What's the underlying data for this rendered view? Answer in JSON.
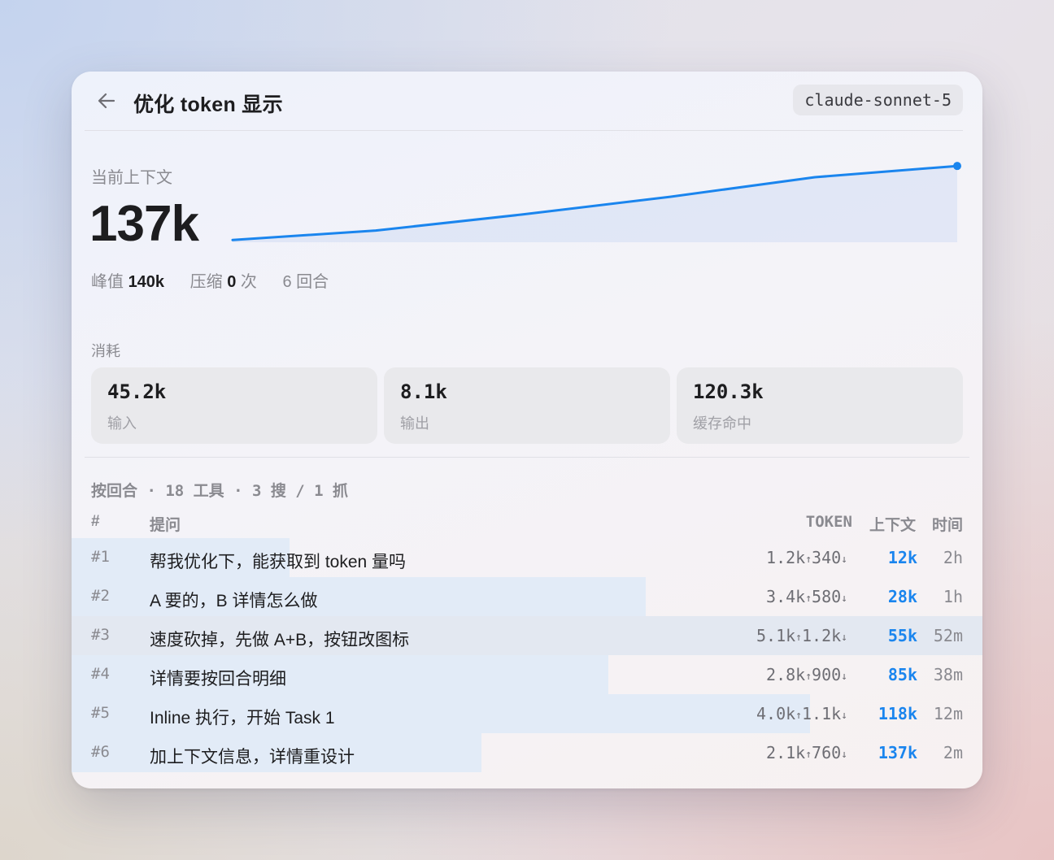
{
  "header": {
    "title": "优化 token 显示",
    "model": "claude-sonnet-5"
  },
  "context": {
    "label": "当前上下文",
    "value": "137k",
    "peak_label": "峰值",
    "peak_value": "140k",
    "compress_label": "压缩",
    "compress_value": "0",
    "compress_unit": "次",
    "rounds": "6 回合"
  },
  "chart_data": {
    "type": "area",
    "x": [
      1,
      2,
      3,
      4,
      5,
      6
    ],
    "values": [
      12,
      28,
      55,
      85,
      118,
      137
    ],
    "unit": "k",
    "color": "#1a85ee"
  },
  "usage": {
    "label": "消耗",
    "cards": [
      {
        "value": "45.2k",
        "label": "输入"
      },
      {
        "value": "8.1k",
        "label": "输出"
      },
      {
        "value": "120.3k",
        "label": "缓存命中"
      }
    ]
  },
  "summary": "按回合 · 18 工具 · 3 搜 / 1 抓",
  "table": {
    "headers": {
      "num": "#",
      "prompt": "提问",
      "token": "TOKEN",
      "context": "上下文",
      "time": "时间"
    },
    "rows": [
      {
        "num": "#1",
        "prompt": "帮我优化下，能获取到 token 量吗",
        "in": "1.2k",
        "out": "340",
        "context": "12k",
        "time": "2h",
        "share": 0.239
      },
      {
        "num": "#2",
        "prompt": "A 要的，B 详情怎么做",
        "in": "3.4k",
        "out": "580",
        "context": "28k",
        "time": "1h",
        "share": 0.63
      },
      {
        "num": "#3",
        "prompt": "速度砍掉，先做 A+B，按钮改图标",
        "in": "5.1k",
        "out": "1.2k",
        "context": "55k",
        "time": "52m",
        "share": 1.0
      },
      {
        "num": "#4",
        "prompt": "详情要按回合明细",
        "in": "2.8k",
        "out": "900",
        "context": "85k",
        "time": "38m",
        "share": 0.589
      },
      {
        "num": "#5",
        "prompt": "Inline 执行，开始 Task 1",
        "in": "4.0k",
        "out": "1.1k",
        "context": "118k",
        "time": "12m",
        "share": 0.811
      },
      {
        "num": "#6",
        "prompt": "加上下文信息，详情重设计",
        "in": "2.1k",
        "out": "760",
        "context": "137k",
        "time": "2m",
        "share": 0.45
      }
    ],
    "highlight_row": 2
  },
  "icons": {
    "back": "arrow-left-icon",
    "up": "↑",
    "down": "↓"
  }
}
